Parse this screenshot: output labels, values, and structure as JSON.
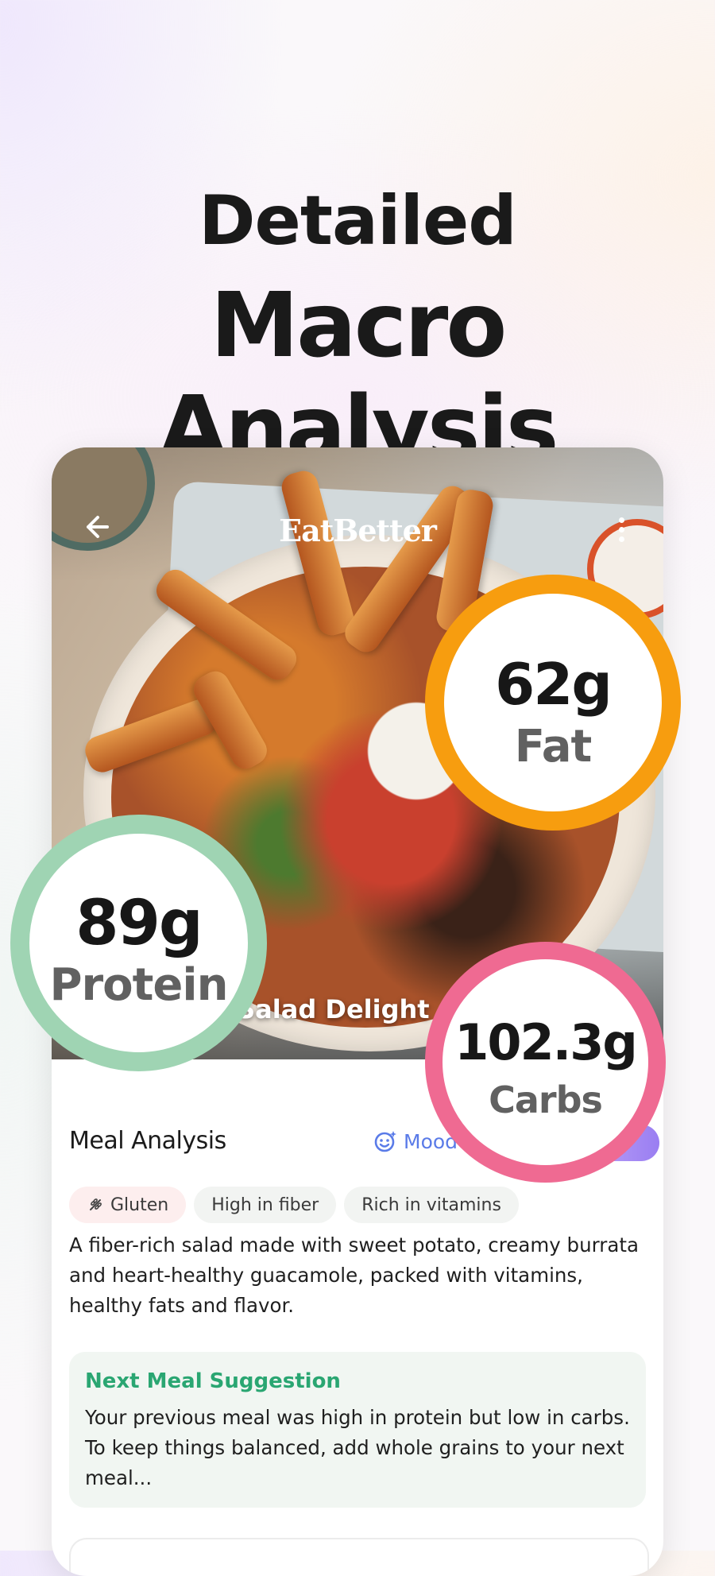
{
  "headline": {
    "line1": "Detailed",
    "line2": "Macro Analysis"
  },
  "app": {
    "title": "EatBetter",
    "back_icon": "arrow-left-icon",
    "menu_icon": "more-vertical-icon"
  },
  "meal": {
    "name": "o Salad Delight"
  },
  "macros": {
    "fat": {
      "value": "62g",
      "label": "Fat",
      "color": "#f79d0f"
    },
    "protein": {
      "value": "89g",
      "label": "Protein",
      "color": "#9fd4b3"
    },
    "carbs": {
      "value": "102.3g",
      "label": "Carbs",
      "color": "#ef6a92"
    }
  },
  "analysis": {
    "title": "Meal Analysis",
    "mood_label": "Mood",
    "mood_icon": "smile-sparkle-icon",
    "tags": [
      "Gluten",
      "High in fiber",
      "Rich in vitamins"
    ],
    "tag_warning_icon": "no-gluten-icon",
    "description": "A fiber-rich salad made with sweet potato, creamy burrata and heart-healthy guacamole, packed with vitamins, healthy fats and flavor."
  },
  "suggestion": {
    "title": "Next Meal Suggestion",
    "body": "Your previous meal was high in protein but low in carbs. To keep things balanced, add whole grains to your next meal..."
  },
  "colors": {
    "accent_green": "#2aa672",
    "accent_blue": "#5a7be8",
    "accent_purple": "#9a7ef2"
  }
}
